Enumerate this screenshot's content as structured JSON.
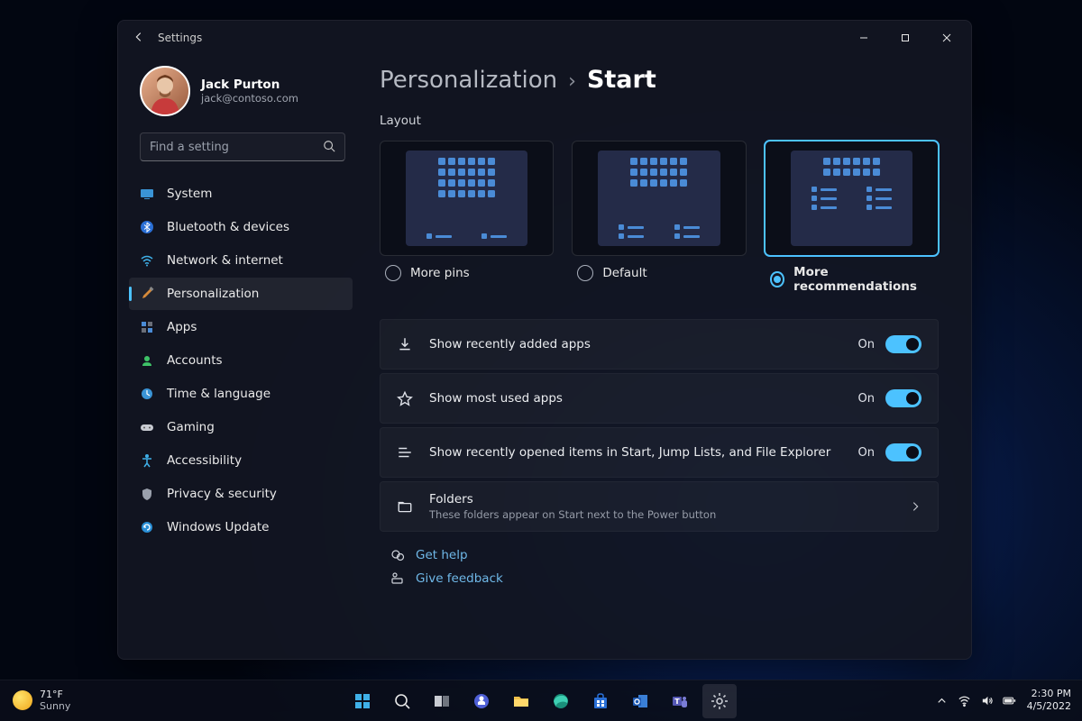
{
  "window": {
    "title": "Settings"
  },
  "user": {
    "name": "Jack Purton",
    "email": "jack@contoso.com"
  },
  "search": {
    "placeholder": "Find a setting"
  },
  "nav": [
    {
      "id": "system",
      "label": "System"
    },
    {
      "id": "bluetooth",
      "label": "Bluetooth & devices"
    },
    {
      "id": "network",
      "label": "Network & internet"
    },
    {
      "id": "personalization",
      "label": "Personalization",
      "active": true
    },
    {
      "id": "apps",
      "label": "Apps"
    },
    {
      "id": "accounts",
      "label": "Accounts"
    },
    {
      "id": "time",
      "label": "Time & language"
    },
    {
      "id": "gaming",
      "label": "Gaming"
    },
    {
      "id": "accessibility",
      "label": "Accessibility"
    },
    {
      "id": "privacy",
      "label": "Privacy & security"
    },
    {
      "id": "update",
      "label": "Windows Update"
    }
  ],
  "breadcrumb": {
    "parent": "Personalization",
    "current": "Start"
  },
  "layout": {
    "section_label": "Layout",
    "options": [
      {
        "label": "More pins",
        "selected": false
      },
      {
        "label": "Default",
        "selected": false
      },
      {
        "label": "More recommendations",
        "selected": true
      }
    ]
  },
  "settings": [
    {
      "icon": "download",
      "title": "Show recently added apps",
      "state": "On"
    },
    {
      "icon": "star",
      "title": "Show most used apps",
      "state": "On"
    },
    {
      "icon": "list",
      "title": "Show recently opened items in Start, Jump Lists, and File Explorer",
      "state": "On"
    }
  ],
  "folders": {
    "title": "Folders",
    "desc": "These folders appear on Start next to the Power button"
  },
  "help": {
    "get_help": "Get help",
    "feedback": "Give feedback"
  },
  "taskbar": {
    "weather_temp": "71°F",
    "weather_cond": "Sunny",
    "time": "2:30 PM",
    "date": "4/5/2022"
  }
}
